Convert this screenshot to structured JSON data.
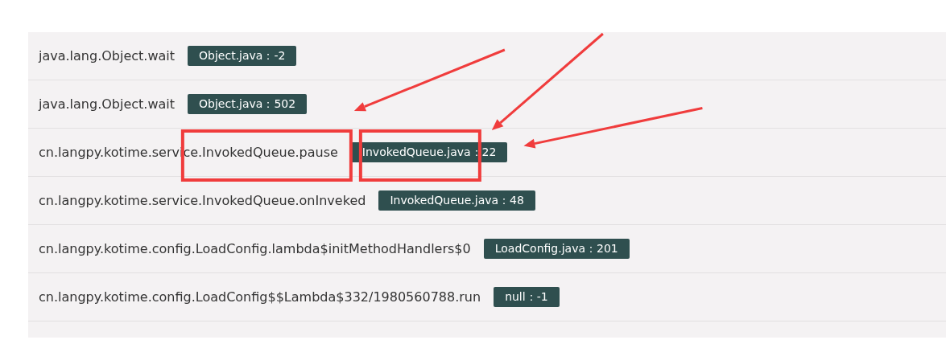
{
  "frames": [
    {
      "method": "java.lang.Object.wait",
      "location": "Object.java：-2"
    },
    {
      "method": "java.lang.Object.wait",
      "location": "Object.java：502"
    },
    {
      "method": "cn.langpy.kotime.service.InvokedQueue.pause",
      "location": "InvokedQueue.java：22",
      "annotations": [
        {
          "kind": "namebox"
        },
        {
          "kind": "tagbox"
        },
        {
          "kind": "namearrow"
        },
        {
          "kind": "tagarrow"
        },
        {
          "kind": "tagendarrow"
        }
      ]
    },
    {
      "method": "cn.langpy.kotime.service.InvokedQueue.onInveked",
      "location": "InvokedQueue.java：48"
    },
    {
      "method": "cn.langpy.kotime.config.LoadConfig.lambda$initMethodHandlers$0",
      "location": "LoadConfig.java：201"
    },
    {
      "method": "cn.langpy.kotime.config.LoadConfig$$Lambda$332/1980560788.run",
      "location": "null：-1"
    }
  ]
}
